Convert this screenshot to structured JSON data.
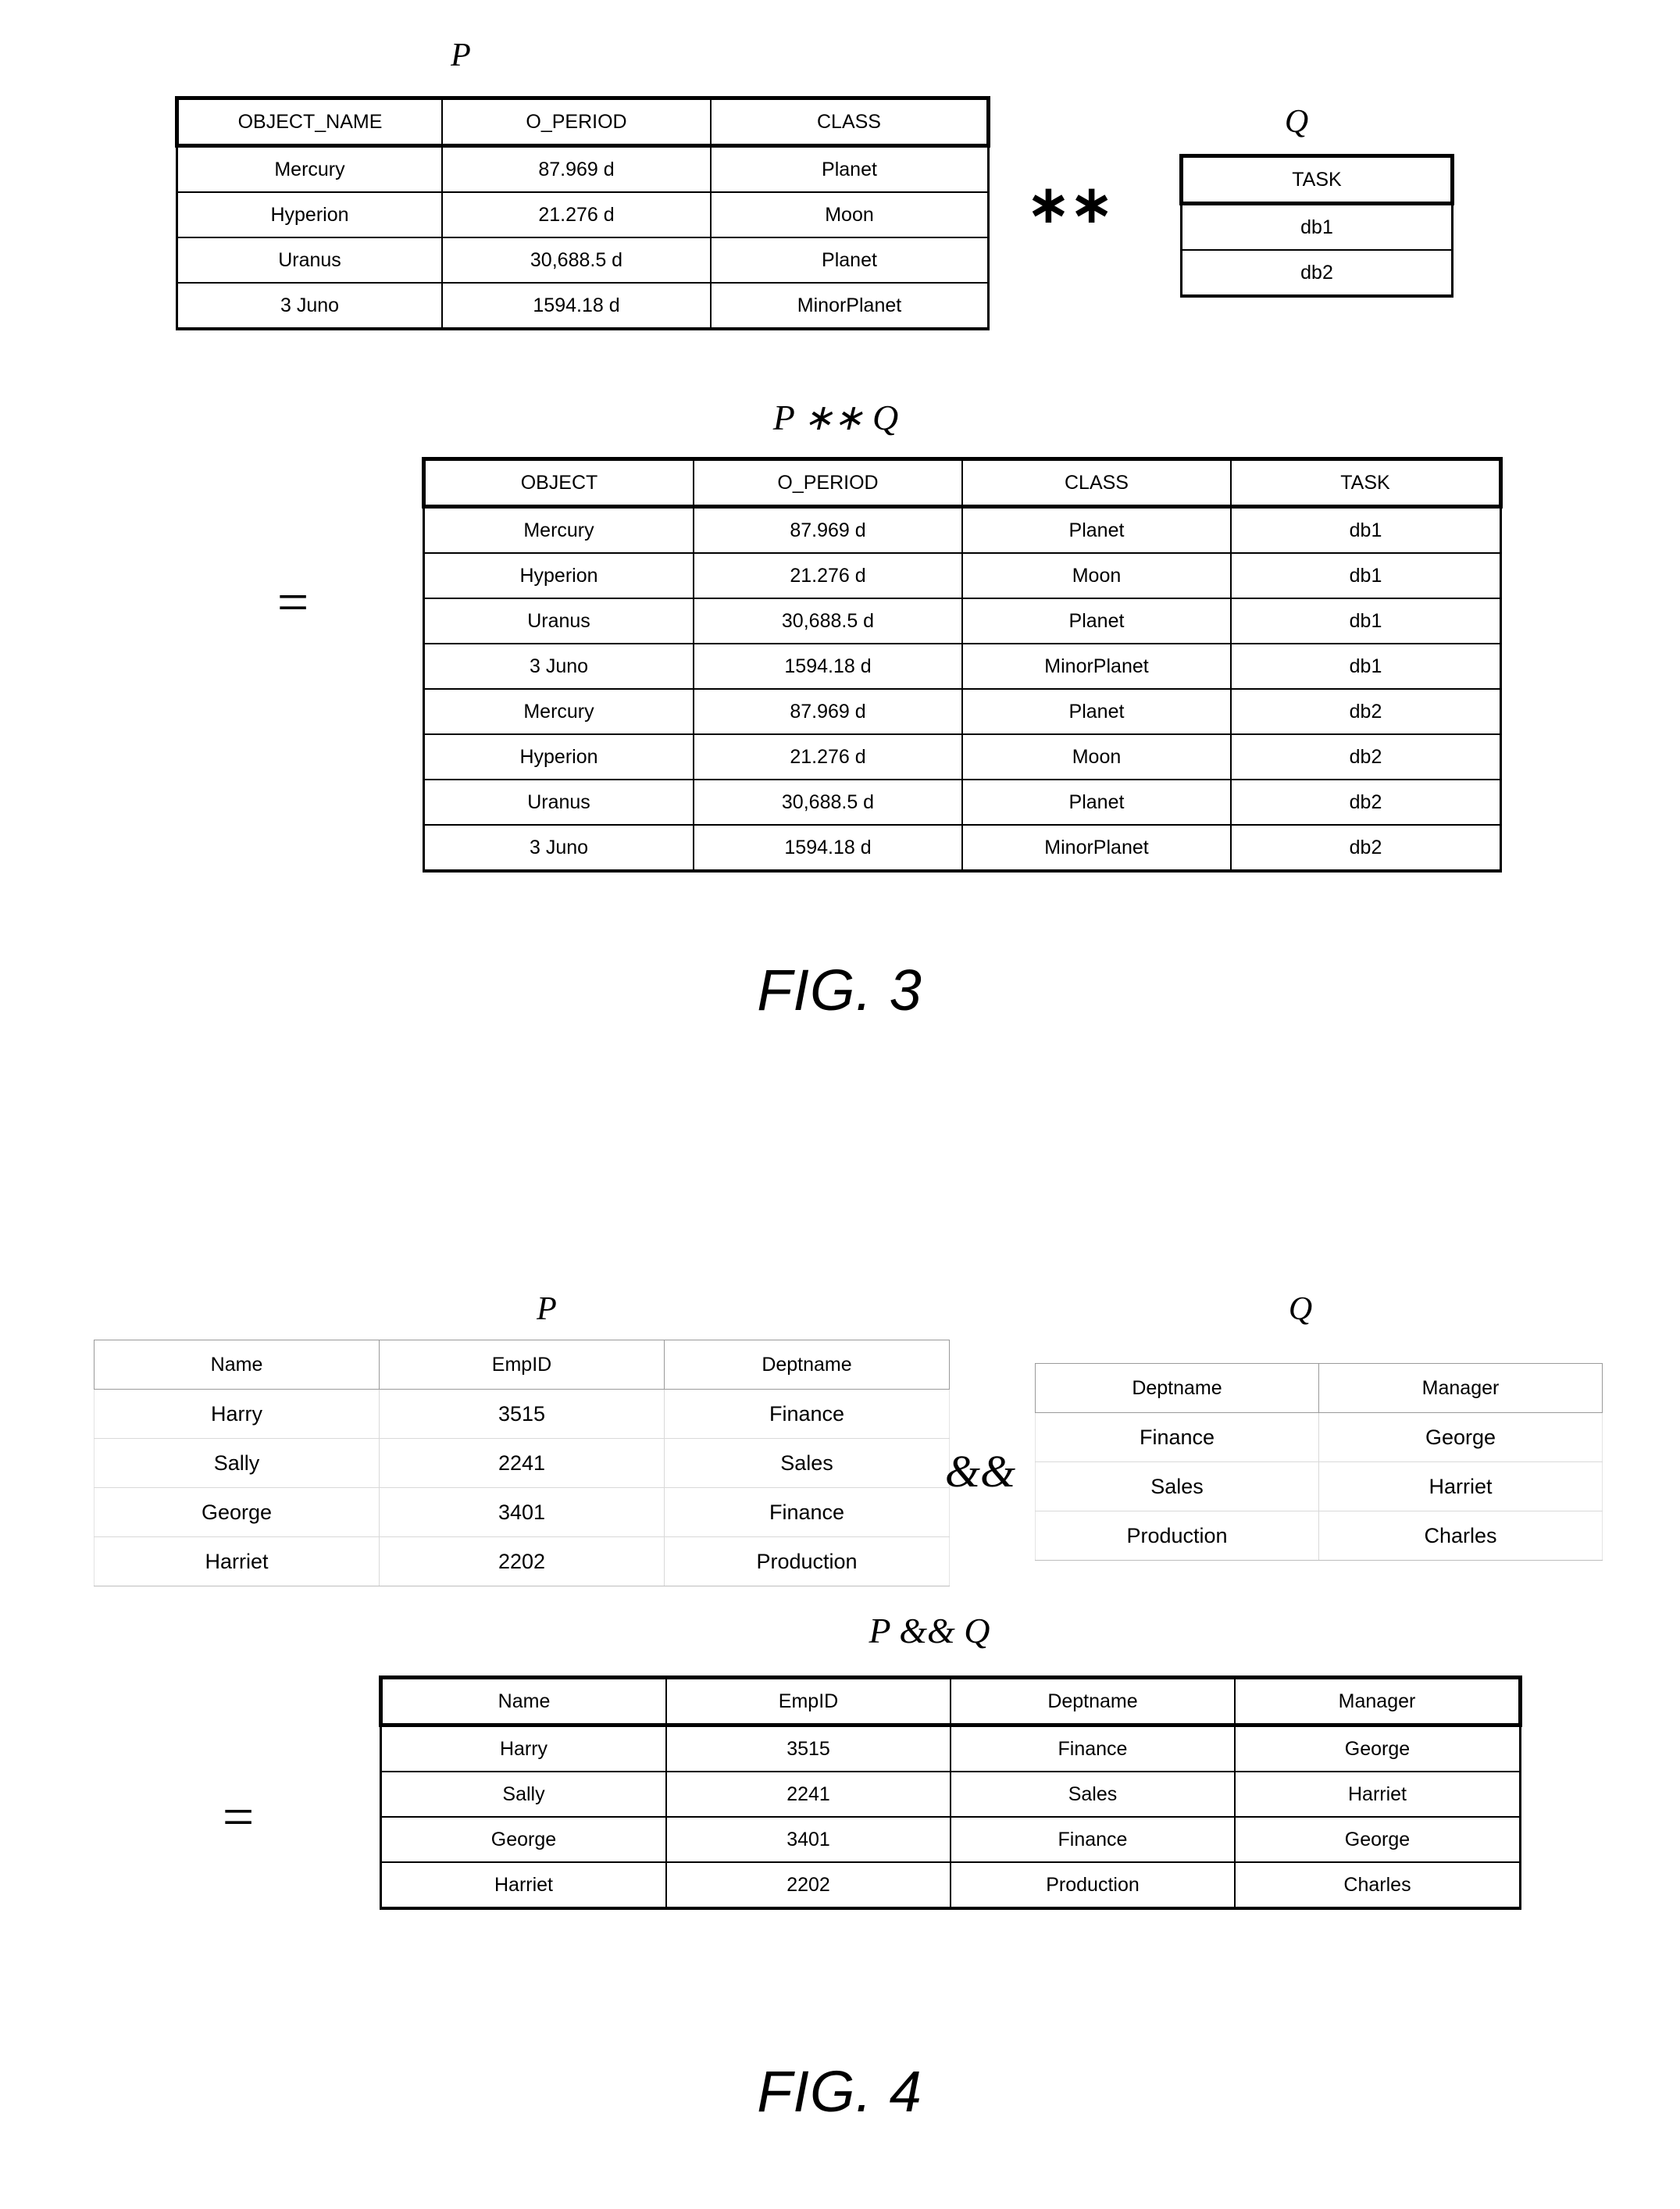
{
  "figures": [
    {
      "id": "fig3",
      "caption": "FIG. 3",
      "operator_symbol": "∗∗",
      "equals_symbol": "=",
      "left_operand": {
        "label": "P",
        "headers": [
          "OBJECT_NAME",
          "O_PERIOD",
          "CLASS"
        ],
        "rows": [
          [
            "Mercury",
            "87.969 d",
            "Planet"
          ],
          [
            "Hyperion",
            "21.276 d",
            "Moon"
          ],
          [
            "Uranus",
            "30,688.5 d",
            "Planet"
          ],
          [
            "3 Juno",
            "1594.18 d",
            "MinorPlanet"
          ]
        ]
      },
      "right_operand": {
        "label": "Q",
        "headers": [
          "TASK"
        ],
        "rows": [
          [
            "db1"
          ],
          [
            "db2"
          ]
        ]
      },
      "result": {
        "label": "P ∗∗ Q",
        "headers": [
          "OBJECT",
          "O_PERIOD",
          "CLASS",
          "TASK"
        ],
        "rows": [
          [
            "Mercury",
            "87.969 d",
            "Planet",
            "db1"
          ],
          [
            "Hyperion",
            "21.276 d",
            "Moon",
            "db1"
          ],
          [
            "Uranus",
            "30,688.5 d",
            "Planet",
            "db1"
          ],
          [
            "3 Juno",
            "1594.18 d",
            "MinorPlanet",
            "db1"
          ],
          [
            "Mercury",
            "87.969 d",
            "Planet",
            "db2"
          ],
          [
            "Hyperion",
            "21.276 d",
            "Moon",
            "db2"
          ],
          [
            "Uranus",
            "30,688.5 d",
            "Planet",
            "db2"
          ],
          [
            "3 Juno",
            "1594.18 d",
            "MinorPlanet",
            "db2"
          ]
        ]
      }
    },
    {
      "id": "fig4",
      "caption": "FIG. 4",
      "operator_symbol": "&&",
      "equals_symbol": "=",
      "left_operand": {
        "label": "P",
        "headers": [
          "Name",
          "EmpID",
          "Deptname"
        ],
        "rows": [
          [
            "Harry",
            "3515",
            "Finance"
          ],
          [
            "Sally",
            "2241",
            "Sales"
          ],
          [
            "George",
            "3401",
            "Finance"
          ],
          [
            "Harriet",
            "2202",
            "Production"
          ]
        ]
      },
      "right_operand": {
        "label": "Q",
        "headers": [
          "Deptname",
          "Manager"
        ],
        "rows": [
          [
            "Finance",
            "George"
          ],
          [
            "Sales",
            "Harriet"
          ],
          [
            "Production",
            "Charles"
          ]
        ]
      },
      "result": {
        "label": "P && Q",
        "headers": [
          "Name",
          "EmpID",
          "Deptname",
          "Manager"
        ],
        "rows": [
          [
            "Harry",
            "3515",
            "Finance",
            "George"
          ],
          [
            "Sally",
            "2241",
            "Sales",
            "Harriet"
          ],
          [
            "George",
            "3401",
            "Finance",
            "George"
          ],
          [
            "Harriet",
            "2202",
            "Production",
            "Charles"
          ]
        ]
      }
    }
  ]
}
